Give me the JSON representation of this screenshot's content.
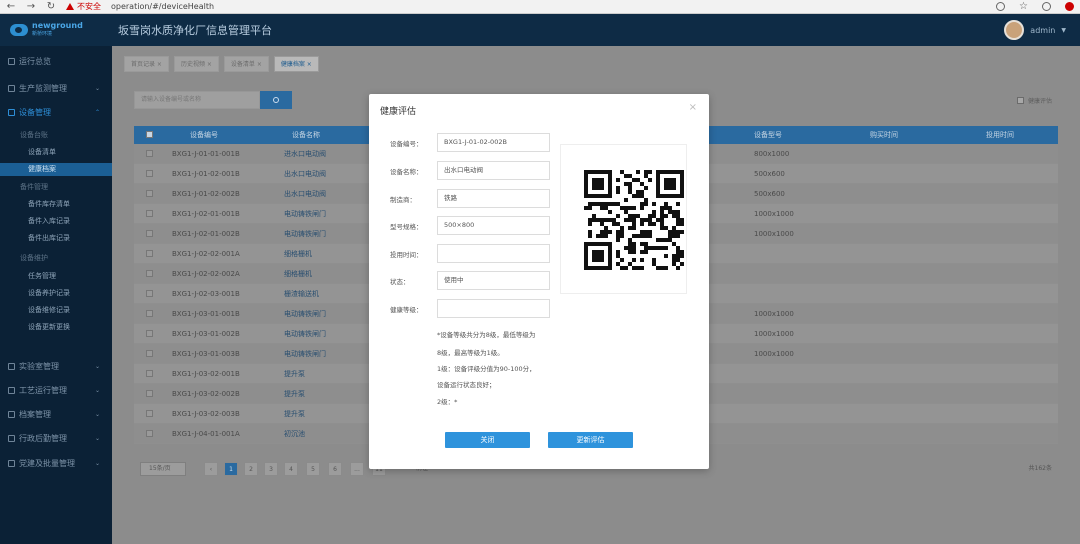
{
  "browser": {
    "security_label": "不安全",
    "url": "operation/#/deviceHealth"
  },
  "header": {
    "logo_en": "newground",
    "logo_cn": "新桥环境",
    "title": "坂雪岗水质净化厂信息管理平台",
    "user": "admin"
  },
  "sidebar": {
    "menus": [
      {
        "label": "运行总览"
      },
      {
        "label": "生产监测管理"
      },
      {
        "label": "设备管理"
      },
      {
        "label": "实验室管理"
      },
      {
        "label": "工艺运行管理"
      },
      {
        "label": "档案管理"
      },
      {
        "label": "行政后勤管理"
      },
      {
        "label": "党建及批量管理"
      }
    ],
    "groups": [
      "设备台账",
      "备件管理",
      "设备维护"
    ],
    "items": [
      "设备清单",
      "健康档案",
      "备件库存清单",
      "备件入库记录",
      "备件出库记录",
      "任务管理",
      "设备养护记录",
      "设备维修记录",
      "设备更新更换"
    ]
  },
  "tabs": [
    "首页记录",
    "历史视频",
    "设备清单",
    "健康档案"
  ],
  "search": {
    "placeholder": "请输入设备编号或名称"
  },
  "health_check_label": "健康评估",
  "table": {
    "headers": [
      "设备编号",
      "设备名称",
      "设备型号",
      "购买时间",
      "投用时间"
    ],
    "rows": [
      {
        "code": "BXG1-J-01-01-001B",
        "name": "进水口电动阀",
        "model": "800x1000"
      },
      {
        "code": "BXG1-J-01-02-001B",
        "name": "出水口电动阀",
        "model": "500x600"
      },
      {
        "code": "BXG1-J-01-02-002B",
        "name": "出水口电动阀",
        "model": "500x600"
      },
      {
        "code": "BXG1-J-02-01-001B",
        "name": "电动铸铁闸门",
        "model": "1000x1000"
      },
      {
        "code": "BXG1-J-02-01-002B",
        "name": "电动铸铁闸门",
        "model": "1000x1000"
      },
      {
        "code": "BXG1-J-02-02-001A",
        "name": "细格栅机",
        "model": ""
      },
      {
        "code": "BXG1-J-02-02-002A",
        "name": "细格栅机",
        "model": ""
      },
      {
        "code": "BXG1-J-02-03-001B",
        "name": "栅渣输送机",
        "model": ""
      },
      {
        "code": "BXG1-J-03-01-001B",
        "name": "电动铸铁闸门",
        "model": "1000x1000"
      },
      {
        "code": "BXG1-J-03-01-002B",
        "name": "电动铸铁闸门",
        "model": "1000x1000"
      },
      {
        "code": "BXG1-J-03-01-003B",
        "name": "电动铸铁闸门",
        "model": "1000x1000"
      },
      {
        "code": "BXG1-J-03-02-001B",
        "name": "提升泵",
        "model": ""
      },
      {
        "code": "BXG1-J-03-02-002B",
        "name": "提升泵",
        "model": ""
      },
      {
        "code": "BXG1-J-03-02-003B",
        "name": "提升泵",
        "model": ""
      },
      {
        "code": "BXG1-J-04-01-001A",
        "name": "初沉池",
        "model": ""
      }
    ]
  },
  "pager": {
    "page_size": "15条/页",
    "pages": [
      "1",
      "2",
      "3",
      "4",
      "5",
      "6",
      "...",
      "11"
    ],
    "goto_label": "前往",
    "total": "共162条"
  },
  "modal": {
    "title": "健康评估",
    "close": "×",
    "fields": [
      {
        "label": "设备编号：",
        "value": "BXG1-J-01-02-002B"
      },
      {
        "label": "设备名称：",
        "value": "出水口电动阀"
      },
      {
        "label": "制造商：",
        "value": "铁路"
      },
      {
        "label": "型号规格：",
        "value": "500×800"
      },
      {
        "label": "投用时间：",
        "value": ""
      },
      {
        "label": "状态：",
        "value": "使用中"
      },
      {
        "label": "健康等级：",
        "value": ""
      }
    ],
    "note_lines": [
      "*设备等级共分为8级，最低等级为",
      "8级，最高等级为1级。",
      "1级：设备评级分值为90-100分，",
      "设备运行状态良好；",
      "2级：*"
    ],
    "close_button": "关闭",
    "update_button": "更新评估"
  }
}
